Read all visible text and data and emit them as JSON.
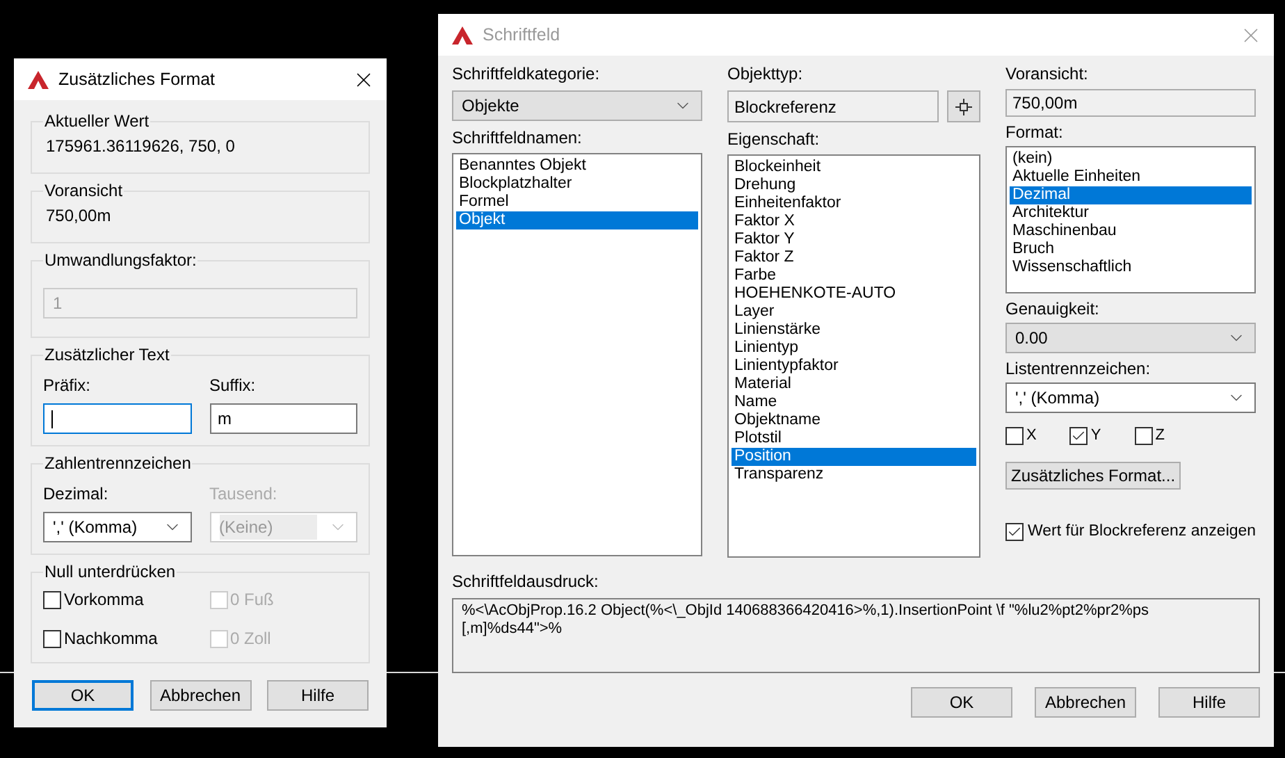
{
  "left_dialog": {
    "title": "Zusätzliches Format",
    "active": true,
    "current_value": {
      "label": "Aktueller Wert",
      "value": "175961.36119626, 750, 0"
    },
    "preview": {
      "label": "Voransicht",
      "value": "750,00m"
    },
    "conversion_factor": {
      "label": "Umwandlungsfaktor:",
      "value": "1",
      "disabled": true
    },
    "additional_text": {
      "label": "Zusätzlicher Text",
      "prefix": {
        "label": "Präfix:",
        "focused": true
      },
      "suffix": {
        "label": "Suffix:",
        "value": "m",
        "focused": false
      }
    },
    "separators": {
      "label": "Zahlentrennzeichen",
      "decimal": {
        "label": "Dezimal:",
        "value": "',' (Komma)",
        "disabled": false
      },
      "thousands": {
        "label": "Tausend:",
        "value": "(Keine)",
        "disabled": true
      }
    },
    "zero_suppression": {
      "label": "Null unterdrücken",
      "options": [
        {
          "label": "Vorkomma",
          "checked": false,
          "disabled": false
        },
        {
          "label": "0 Fuß",
          "checked": false,
          "disabled": true
        },
        {
          "label": "Nachkomma",
          "checked": false,
          "disabled": false
        },
        {
          "label": "0 Zoll",
          "checked": false,
          "disabled": true
        }
      ]
    },
    "buttons": [
      {
        "label": "OK",
        "default": true
      },
      {
        "label": "Abbrechen",
        "default": false
      },
      {
        "label": "Hilfe",
        "default": false
      }
    ]
  },
  "right_dialog": {
    "title": "Schriftfeld",
    "active": false,
    "category": {
      "label": "Schriftfeldkategorie:",
      "value": "Objekte"
    },
    "field_names": {
      "label": "Schriftfeldnamen:",
      "items": [
        {
          "label": "Benanntes Objekt",
          "selected": false
        },
        {
          "label": "Blockplatzhalter",
          "selected": false
        },
        {
          "label": "Formel",
          "selected": false
        },
        {
          "label": "Objekt",
          "selected": true
        }
      ]
    },
    "object_type": {
      "label": "Objekttyp:",
      "value": "Blockreferenz"
    },
    "property": {
      "label": "Eigenschaft:",
      "items": [
        {
          "label": "Blockeinheit",
          "selected": false
        },
        {
          "label": "Drehung",
          "selected": false
        },
        {
          "label": "Einheitenfaktor",
          "selected": false
        },
        {
          "label": "Faktor X",
          "selected": false
        },
        {
          "label": "Faktor Y",
          "selected": false
        },
        {
          "label": "Faktor Z",
          "selected": false
        },
        {
          "label": "Farbe",
          "selected": false
        },
        {
          "label": "HOEHENKOTE-AUTO",
          "selected": false
        },
        {
          "label": "Layer",
          "selected": false
        },
        {
          "label": "Linienstärke",
          "selected": false
        },
        {
          "label": "Linientyp",
          "selected": false
        },
        {
          "label": "Linientypfaktor",
          "selected": false
        },
        {
          "label": "Material",
          "selected": false
        },
        {
          "label": "Name",
          "selected": false
        },
        {
          "label": "Objektname",
          "selected": false
        },
        {
          "label": "Plotstil",
          "selected": false
        },
        {
          "label": "Position",
          "selected": true
        },
        {
          "label": "Transparenz",
          "selected": false
        }
      ]
    },
    "preview": {
      "label": "Voransicht:",
      "value": "750,00m"
    },
    "format": {
      "label": "Format:",
      "items": [
        {
          "label": "(kein)",
          "selected": false
        },
        {
          "label": "Aktuelle Einheiten",
          "selected": false
        },
        {
          "label": "Dezimal",
          "selected": true
        },
        {
          "label": "Architektur",
          "selected": false
        },
        {
          "label": "Maschinenbau",
          "selected": false
        },
        {
          "label": "Bruch",
          "selected": false
        },
        {
          "label": "Wissenschaftlich",
          "selected": false
        }
      ]
    },
    "precision": {
      "label": "Genauigkeit:",
      "value": "0.00"
    },
    "list_separator": {
      "label": "Listentrennzeichen:",
      "value": "',' (Komma)"
    },
    "axes": [
      {
        "label": "X",
        "checked": false
      },
      {
        "label": "Y",
        "checked": true
      },
      {
        "label": "Z",
        "checked": false
      }
    ],
    "additional_format_button": "Zusätzliches Format...",
    "show_block_value": {
      "label": "Wert für Blockreferenz anzeigen",
      "checked": true
    },
    "expression": {
      "label": "Schriftfeldausdruck:",
      "lines": [
        "%<\\AcObjProp.16.2 Object(%<\\_ObjId 140688366420416>%,1).InsertionPoint \\f \"%lu2%pt2%pr2%ps",
        "[,m]%ds44\">%"
      ]
    },
    "buttons": [
      {
        "label": "OK",
        "default": false
      },
      {
        "label": "Abbrechen",
        "default": false
      },
      {
        "label": "Hilfe",
        "default": false
      }
    ]
  }
}
